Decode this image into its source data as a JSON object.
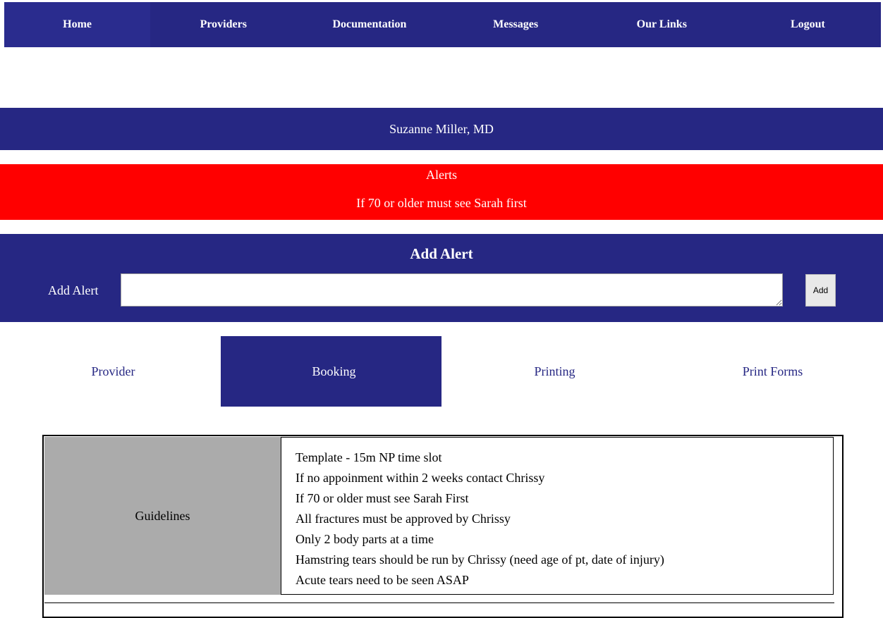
{
  "nav": {
    "items": [
      "Home",
      "Providers",
      "Documentation",
      "Messages",
      "Our Links",
      "Logout"
    ]
  },
  "provider": {
    "name": "Suzanne Miller, MD"
  },
  "alerts": {
    "title": "Alerts",
    "message": "If 70 or older must see Sarah first"
  },
  "add_alert": {
    "heading": "Add Alert",
    "label": "Add Alert",
    "input_value": "",
    "button_label": "Add"
  },
  "tabs": [
    {
      "label": "Provider"
    },
    {
      "label": "Booking",
      "active": true
    },
    {
      "label": "Printing"
    },
    {
      "label": "Print Forms"
    }
  ],
  "guidelines": {
    "label": "Guidelines",
    "items": [
      "Template - 15m NP time slot",
      "If no appoinment within 2 weeks contact Chrissy",
      "If 70 or older must see Sarah First",
      "All fractures must be approved by Chrissy",
      "Only 2 body parts at a time",
      "Hamstring tears should be run by Chrissy (need age of pt, date of injury)",
      "Acute tears need to be seen ASAP"
    ]
  },
  "colors": {
    "brand_navy": "#262783",
    "alert_red": "#ff0000",
    "guidelines_gray": "#ababab"
  }
}
